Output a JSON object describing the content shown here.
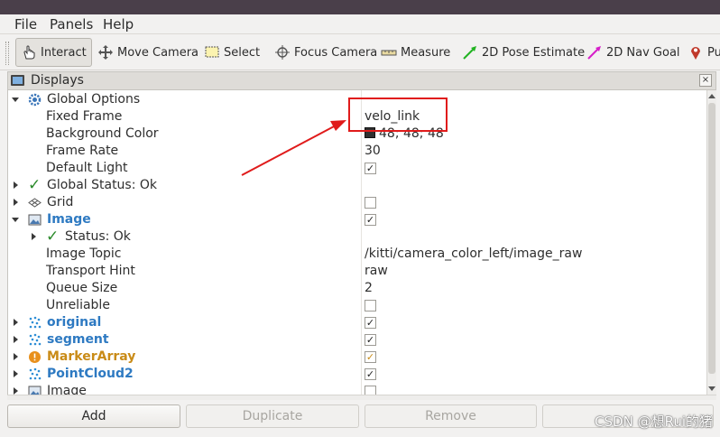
{
  "menubar": {
    "file": "File",
    "panels": "Panels",
    "help": "Help"
  },
  "toolbar": {
    "tools": [
      {
        "label": "Interact",
        "icon": "hand-pointer-icon"
      },
      {
        "label": "Move Camera",
        "icon": "move-camera-icon"
      },
      {
        "label": "Select",
        "icon": "select-rect-icon"
      },
      {
        "label": "Focus Camera",
        "icon": "focus-target-icon"
      },
      {
        "label": "Measure",
        "icon": "ruler-icon"
      },
      {
        "label": "2D Pose Estimate",
        "icon": "green-arrow-icon"
      },
      {
        "label": "2D Nav Goal",
        "icon": "pink-arrow-icon"
      },
      {
        "label": "Pul",
        "icon": "map-pin-icon"
      }
    ]
  },
  "displays": {
    "title": "Displays",
    "close": "×",
    "rows": {
      "global_options": {
        "label": "Global Options"
      },
      "fixed_frame": {
        "label": "Fixed Frame",
        "value": "velo_link"
      },
      "background_color": {
        "label": "Background Color",
        "value": "48; 48; 48"
      },
      "frame_rate": {
        "label": "Frame Rate",
        "value": "30"
      },
      "default_light": {
        "label": "Default Light",
        "checked": true
      },
      "global_status": {
        "label": "Global Status: Ok"
      },
      "grid": {
        "label": "Grid",
        "checked": false
      },
      "image": {
        "label": "Image",
        "checked": true
      },
      "status": {
        "label": "Status: Ok"
      },
      "image_topic": {
        "label": "Image Topic",
        "value": "/kitti/camera_color_left/image_raw"
      },
      "transport_hint": {
        "label": "Transport Hint",
        "value": "raw"
      },
      "queue_size": {
        "label": "Queue Size",
        "value": "2"
      },
      "unreliable": {
        "label": "Unreliable",
        "checked": false
      },
      "original": {
        "label": "original",
        "checked": true
      },
      "segment": {
        "label": "segment",
        "checked": true
      },
      "marker_array": {
        "label": "MarkerArray",
        "checked": true
      },
      "pointcloud2": {
        "label": "PointCloud2",
        "checked": true
      },
      "image2": {
        "label": "Image",
        "checked": false
      }
    }
  },
  "buttons": {
    "add": "Add",
    "duplicate": "Duplicate",
    "remove": "Remove"
  },
  "watermark": "CSDN @想Rui的猪",
  "colors": {
    "blue_label": "#2e7ac2",
    "orange_label": "#c98b17",
    "annotation_red": "#e01b1b",
    "ok_green": "#2a8a2a"
  }
}
